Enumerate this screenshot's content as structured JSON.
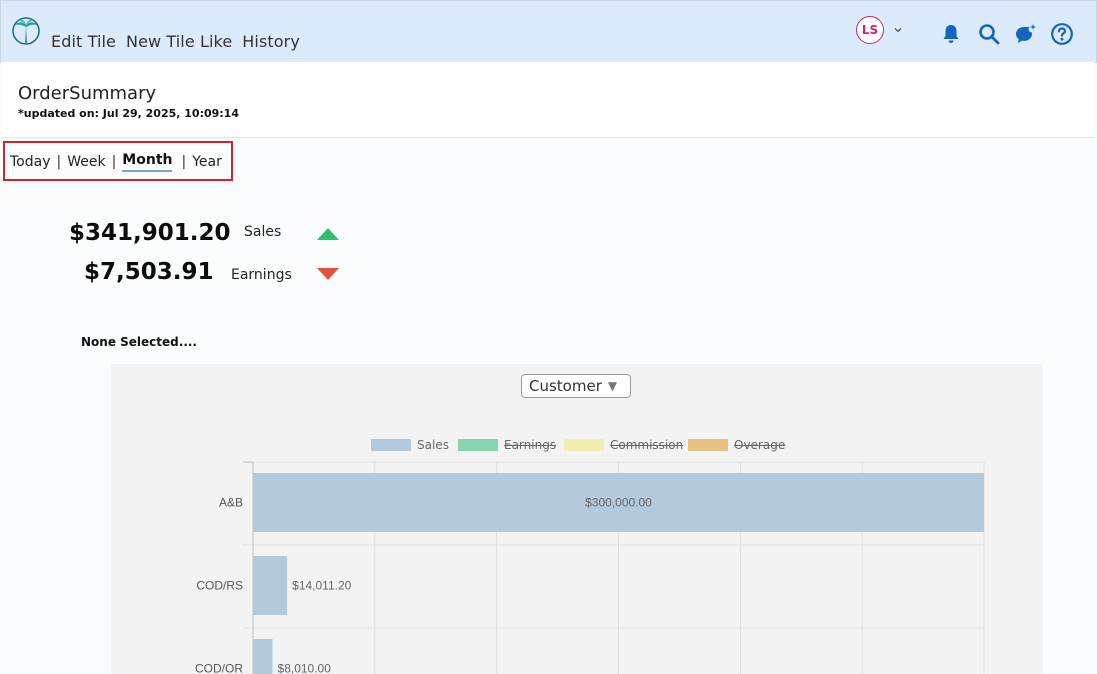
{
  "header": {
    "menu": [
      "Edit Tile",
      "New Tile Like",
      "History"
    ],
    "avatar_initials": "LS"
  },
  "tile": {
    "title": "OrderSummary",
    "updated": "*updated on: Jul 29, 2025, 10:09:14"
  },
  "periods": {
    "items": [
      "Today",
      "Week",
      "Month",
      "Year"
    ],
    "active": "Month"
  },
  "kpis": [
    {
      "value": "$341,901.20",
      "label": "Sales",
      "trend": "up",
      "color": "#2ec06a"
    },
    {
      "value": "$7,503.91",
      "label": "Earnings",
      "trend": "down",
      "color": "#e0533f"
    }
  ],
  "selection_text": "None Selected....",
  "dropdown": {
    "selected": "Customer"
  },
  "chart_data": {
    "type": "bar",
    "orientation": "horizontal",
    "categories": [
      "A&B",
      "COD/RS",
      "COD/OR"
    ],
    "series": [
      {
        "name": "Sales",
        "color": "#b3c9dc",
        "hidden": false,
        "values": [
          300000.0,
          14011.2,
          8010.0
        ]
      },
      {
        "name": "Earnings",
        "color": "#89d4b0",
        "hidden": true,
        "values": []
      },
      {
        "name": "Commission",
        "color": "#f2eeb0",
        "hidden": true,
        "values": []
      },
      {
        "name": "Overage",
        "color": "#e8c283",
        "hidden": true,
        "values": []
      }
    ],
    "data_labels": [
      "$300,000.00",
      "$14,011.20",
      "$8,010.00"
    ],
    "xlim": [
      0,
      300000
    ],
    "grid": true,
    "legend": "top"
  }
}
